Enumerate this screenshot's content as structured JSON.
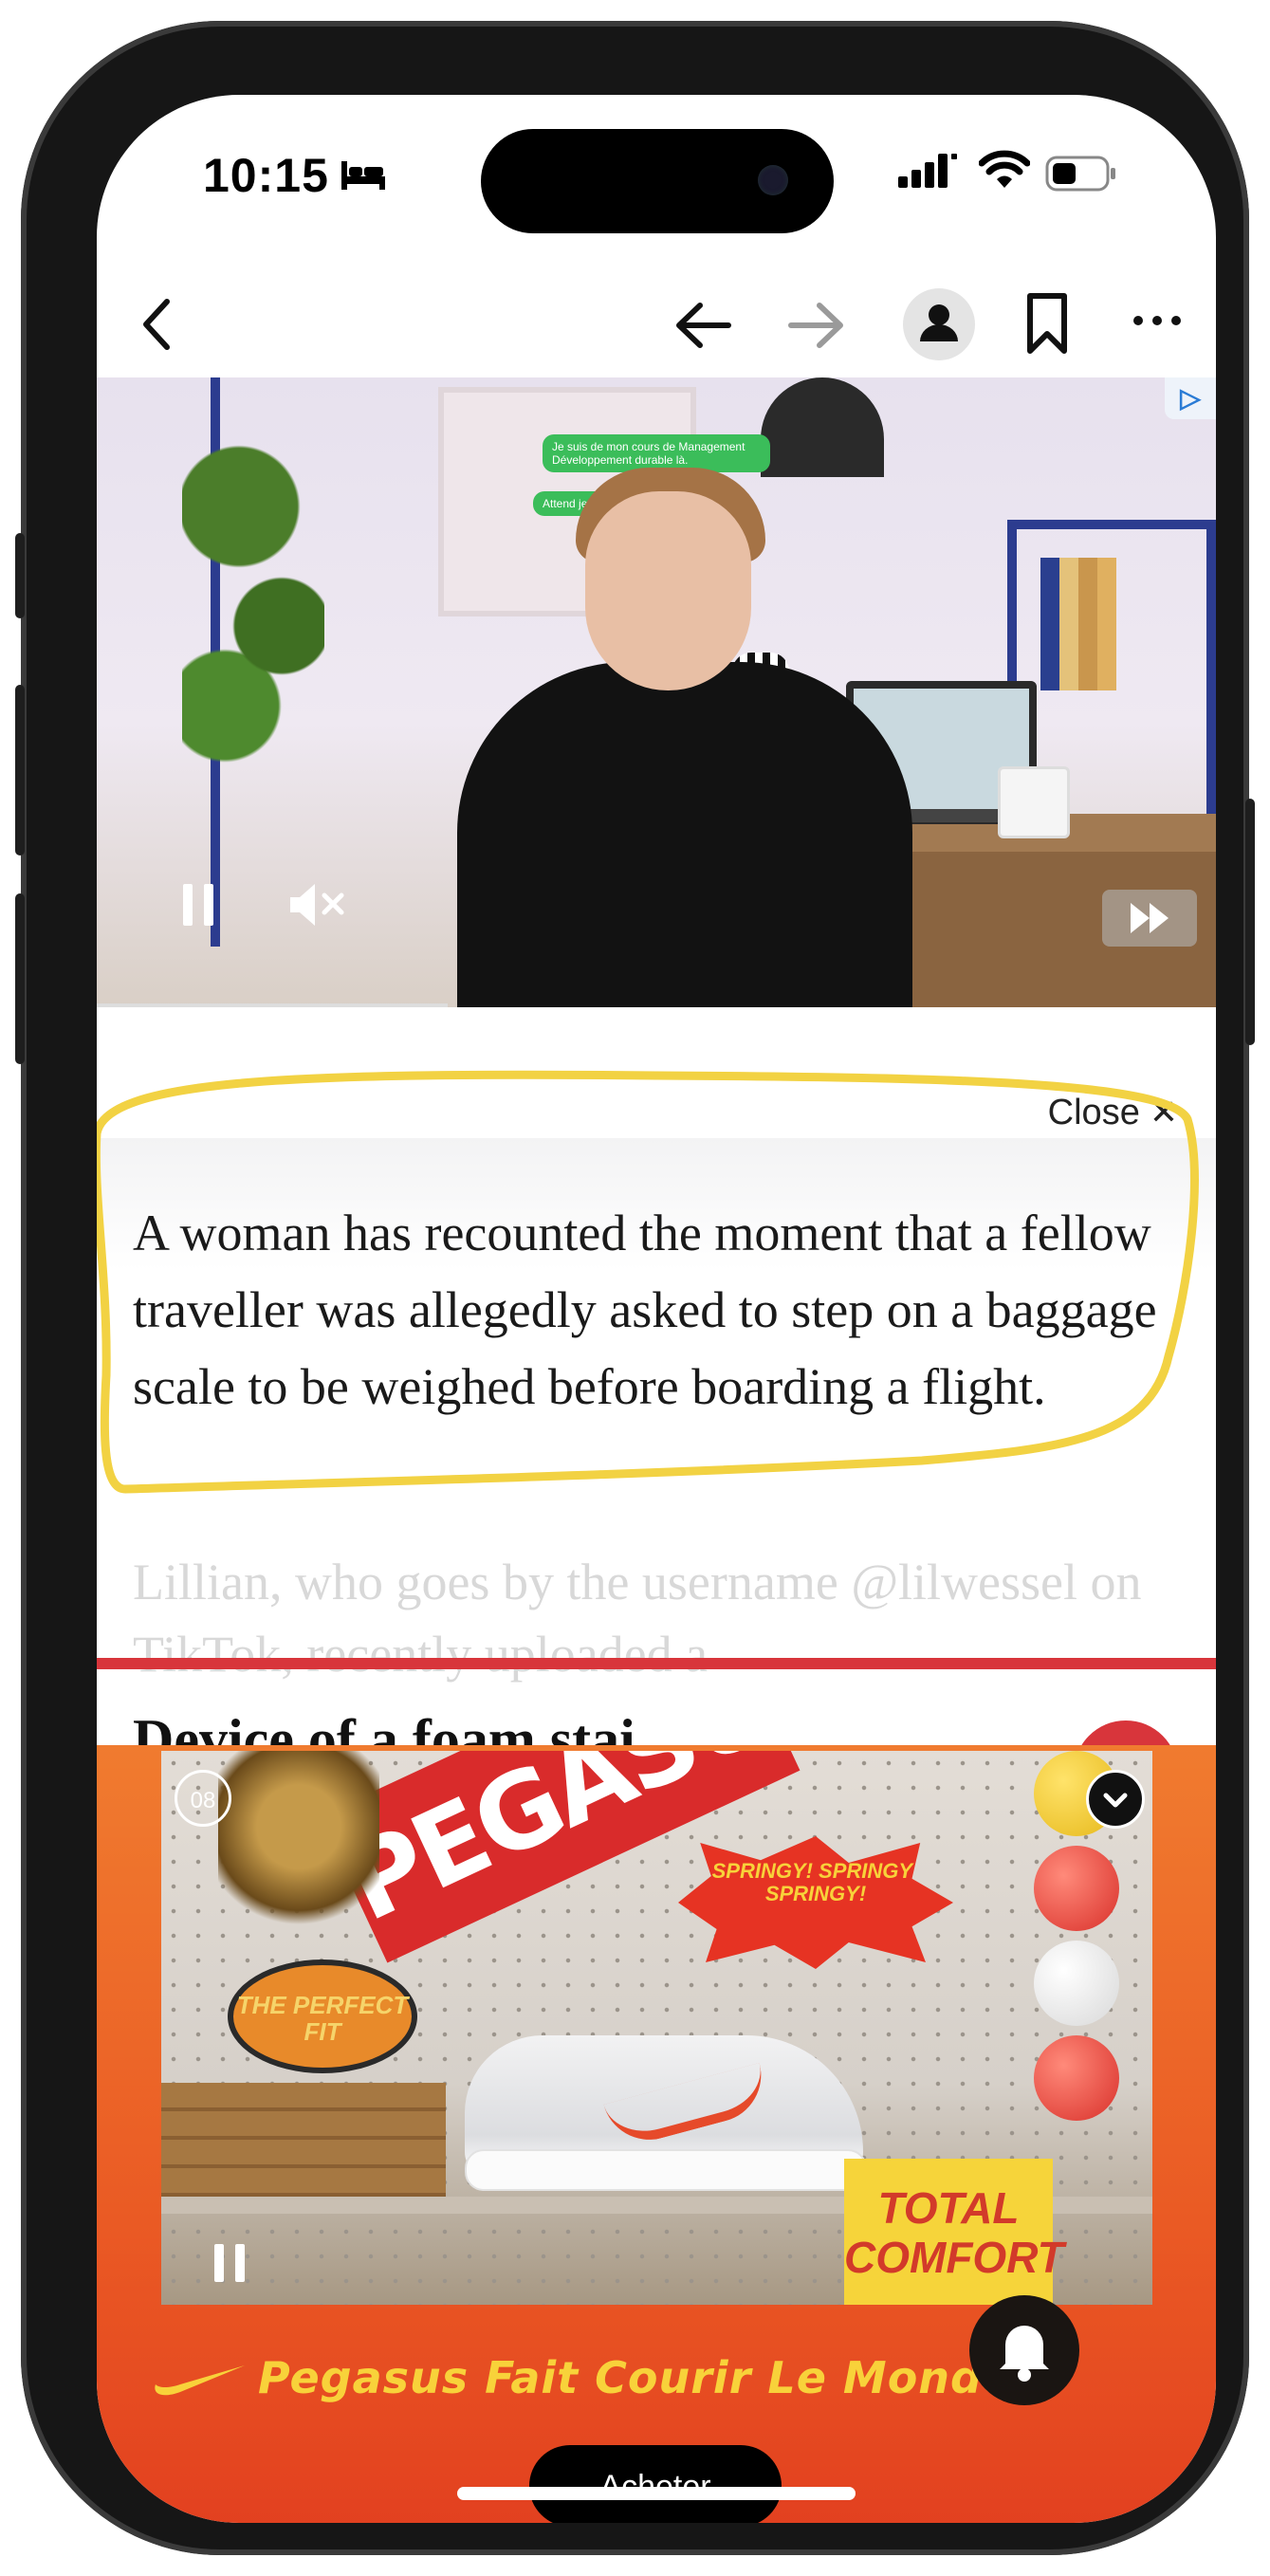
{
  "status_bar": {
    "time": "10:15"
  },
  "browser_toolbar": {
    "icons": [
      "chevron-back-icon",
      "back-arrow-icon",
      "forward-arrow-icon",
      "profile-icon",
      "bookmark-icon",
      "more-icon"
    ]
  },
  "video_ad_top": {
    "chat_lines": [
      "Je suis de mon cours de Management Développement durable là.",
      "Attend je te montre ça"
    ],
    "controls": [
      "pause-icon",
      "mute-icon",
      "fast-forward-icon"
    ]
  },
  "close_label": "Close",
  "article": {
    "paragraph": "A woman has recounted the moment that a fellow traveller was allegedly asked to step on a baggage scale to be weighed before boarding a flight.",
    "faded_text": "Lillian, who goes by the username @lilwessel on TikTok, recently uploaded a",
    "next_heading": "Device of a foam stai"
  },
  "nike_ad": {
    "timer": "08",
    "banner_text": "PEGASUS",
    "burst_text": "SPRINGY! SPRINGY! SPRINGY!",
    "oval_text": "THE PERFECT FIT",
    "sign_text": "TOTAL COMFORT",
    "tagline": "Pegasus Fait Courir Le Monde",
    "buy_label": "Acheter"
  },
  "colors": {
    "accent_red": "#d8353b",
    "ad_orange": "#ea5a24",
    "tagline_yellow": "#f8d23a",
    "highlight_yellow": "#f2d243"
  }
}
